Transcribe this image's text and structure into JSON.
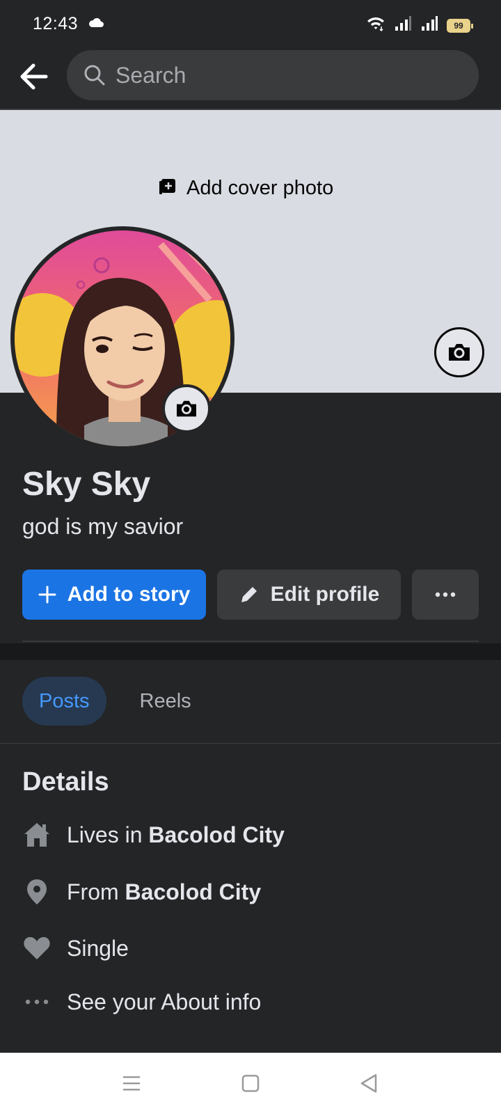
{
  "status_bar": {
    "time": "12:43",
    "battery": "99"
  },
  "search": {
    "placeholder": "Search"
  },
  "cover": {
    "add_label": "Add cover photo"
  },
  "profile": {
    "name": "Sky Sky",
    "bio": "god is my savior"
  },
  "actions": {
    "add_story": "Add to story",
    "edit_profile": "Edit profile"
  },
  "tabs": [
    {
      "label": "Posts",
      "active": true
    },
    {
      "label": "Reels",
      "active": false
    }
  ],
  "details": {
    "title": "Details",
    "lives_prefix": "Lives in ",
    "lives_city": "Bacolod City",
    "from_prefix": "From ",
    "from_city": "Bacolod City",
    "relationship": "Single",
    "about_link": "See your About info"
  },
  "colors": {
    "primary": "#1b74e4",
    "background": "#242527",
    "cover": "#d9dce2",
    "tab_active_bg": "#263951",
    "tab_active_text": "#4599ff"
  }
}
